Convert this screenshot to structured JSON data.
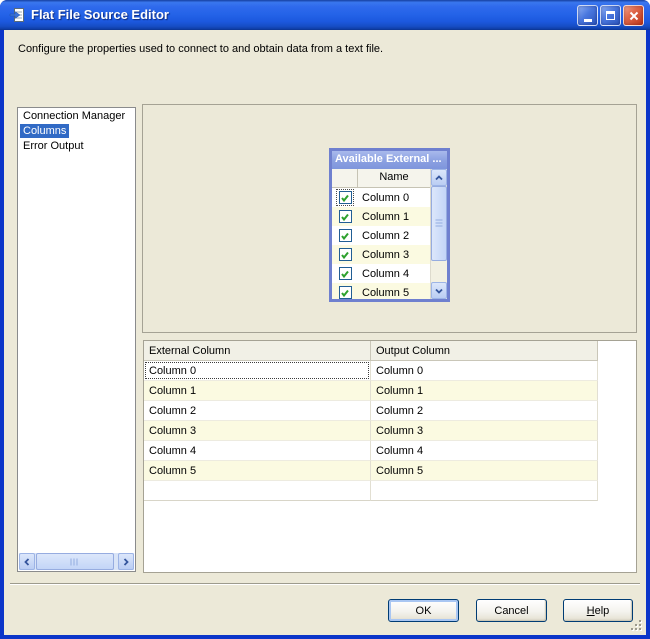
{
  "window": {
    "title": "Flat File Source Editor",
    "description": "Configure the properties used to connect to and obtain data from a text file.",
    "icons": {
      "app_icon": "flat-file-source-document-with-arrow",
      "titlebar_buttons": [
        "minimize-icon",
        "maximize-icon",
        "close-icon"
      ]
    }
  },
  "sidebar": {
    "items": [
      {
        "label": "Connection Manager",
        "selected": false
      },
      {
        "label": "Columns",
        "selected": true
      },
      {
        "label": "Error Output",
        "selected": false
      }
    ]
  },
  "available_panel": {
    "title": "Available External ...",
    "name_header": "Name",
    "rows": [
      {
        "name": "Column 0",
        "checked": true
      },
      {
        "name": "Column 1",
        "checked": true
      },
      {
        "name": "Column 2",
        "checked": true
      },
      {
        "name": "Column 3",
        "checked": true
      },
      {
        "name": "Column 4",
        "checked": true
      },
      {
        "name": "Column 5",
        "checked": true
      }
    ]
  },
  "mapping_table": {
    "headers": [
      "External Column",
      "Output Column"
    ],
    "rows": [
      {
        "external": "Column 0",
        "output": "Column 0"
      },
      {
        "external": "Column 1",
        "output": "Column 1"
      },
      {
        "external": "Column 2",
        "output": "Column 2"
      },
      {
        "external": "Column 3",
        "output": "Column 3"
      },
      {
        "external": "Column 4",
        "output": "Column 4"
      },
      {
        "external": "Column 5",
        "output": "Column 5"
      }
    ]
  },
  "footer": {
    "ok_label": "OK",
    "cancel_label": "Cancel",
    "help_label": "Help"
  },
  "colors": {
    "titlebar_blue": "#2463E8",
    "window_border_blue": "#0B35C9",
    "client_beige": "#ECE9D8",
    "selection_blue": "#316AC5",
    "row_stripe_cream": "#FBFAE1",
    "panel_header_blue": "#8BA0E1",
    "checkbox_green": "#2DA12D"
  }
}
